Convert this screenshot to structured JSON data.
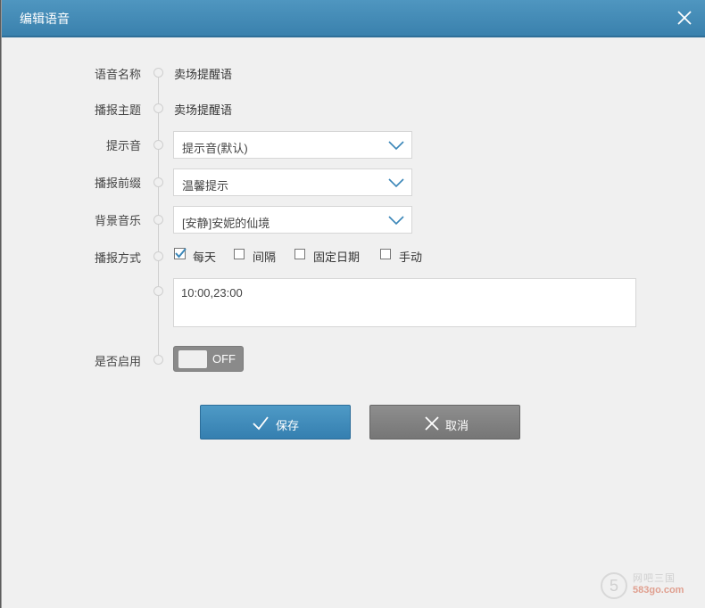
{
  "window": {
    "title": "编辑语音",
    "close_icon": "close-icon"
  },
  "form": {
    "voice_name": {
      "label": "语音名称",
      "value": "卖场提醒语"
    },
    "broadcast_topic": {
      "label": "播报主题",
      "value": "卖场提醒语"
    },
    "prompt_tone": {
      "label": "提示音",
      "value": "提示音(默认)"
    },
    "broadcast_prefix": {
      "label": "播报前缀",
      "value": "温馨提示"
    },
    "background_music": {
      "label": "背景音乐",
      "value": "[安静]安妮的仙境"
    },
    "broadcast_mode": {
      "label": "播报方式",
      "options": [
        {
          "label": "每天",
          "checked": true
        },
        {
          "label": "间隔",
          "checked": false
        },
        {
          "label": "固定日期",
          "checked": false
        },
        {
          "label": "手动",
          "checked": false
        }
      ]
    },
    "times": {
      "value": "10:00,23:00"
    },
    "enabled": {
      "label": "是否启用",
      "state": "OFF"
    }
  },
  "buttons": {
    "save": "保存",
    "cancel": "取消"
  },
  "watermark": {
    "mark": "5",
    "line1": "网吧三国",
    "line2": "583go.com"
  },
  "colors": {
    "titlebar": "#3f88b5",
    "save_button": "#3f88b5",
    "cancel_button": "#808080",
    "toggle_off": "#8a8a8a",
    "check_accent": "#3a86b8"
  }
}
